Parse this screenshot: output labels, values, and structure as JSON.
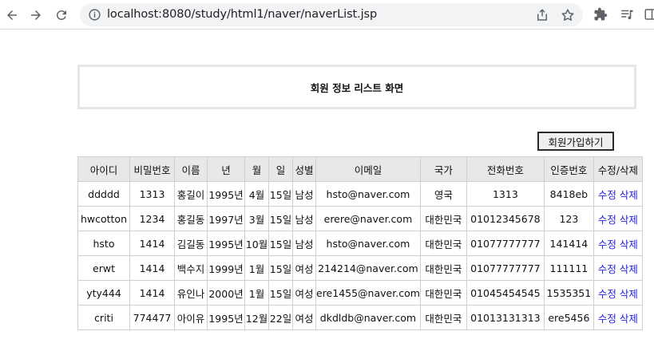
{
  "browser": {
    "url": "localhost:8080/study/html1/naver/naverList.jsp"
  },
  "page": {
    "title": "회원 정보 리스트 화면",
    "join_button": "회원가입하기"
  },
  "table": {
    "headers": [
      "아이디",
      "비밀번호",
      "이름",
      "년",
      "월",
      "일",
      "성별",
      "이메일",
      "국가",
      "전화번호",
      "인증번호",
      "수정/삭제"
    ],
    "edit_label": "수정",
    "delete_label": "삭제",
    "rows": [
      [
        "ddddd",
        "1313",
        "홍길이",
        "1995년",
        "4월",
        "15일",
        "남성",
        "hsto@naver.com",
        "영국",
        "1313",
        "8418eb"
      ],
      [
        "hwcotton",
        "1234",
        "홍길동",
        "1997년",
        "3월",
        "15일",
        "남성",
        "erere@naver.com",
        "대한민국",
        "01012345678",
        "123"
      ],
      [
        "hsto",
        "1414",
        "김길동",
        "1995년",
        "10월",
        "15일",
        "남성",
        "hsto@naver.com",
        "대한민국",
        "01077777777",
        "141414"
      ],
      [
        "erwt",
        "1414",
        "백수지",
        "1999년",
        "1월",
        "15일",
        "여성",
        "214214@naver.com",
        "대한민국",
        "01077777777",
        "111111"
      ],
      [
        "yty444",
        "1414",
        "유인나",
        "2000년",
        "1월",
        "15일",
        "여성",
        "ere1455@naver.com",
        "대한민국",
        "01045454545",
        "1535351"
      ],
      [
        "criti",
        "774477",
        "아이유",
        "1995년",
        "12월",
        "22일",
        "여성",
        "dkdldb@naver.com",
        "대한민국",
        "01013131313",
        "ere5456"
      ]
    ]
  }
}
